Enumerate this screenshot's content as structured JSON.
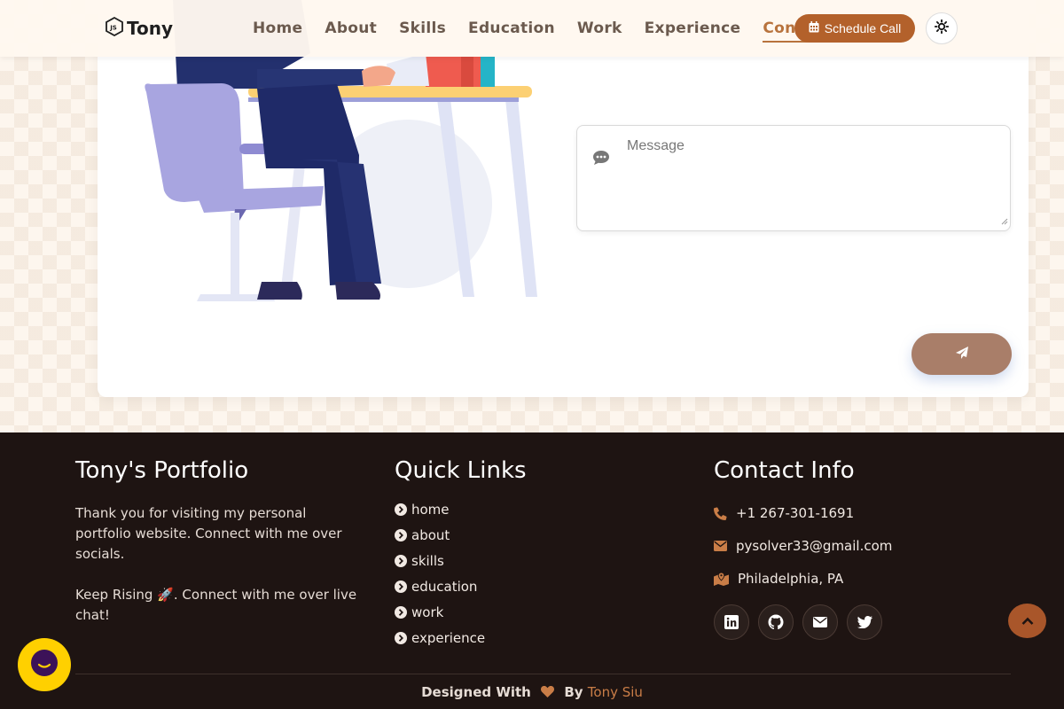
{
  "header": {
    "logo_text": "Tony",
    "nav": [
      {
        "label": "Home"
      },
      {
        "label": "About"
      },
      {
        "label": "Skills"
      },
      {
        "label": "Education"
      },
      {
        "label": "Work"
      },
      {
        "label": "Experience"
      },
      {
        "label": "Contact",
        "active": true
      }
    ],
    "schedule_label": "Schedule Call",
    "theme_icon": "sun-icon"
  },
  "contact_form": {
    "message_placeholder": "Message",
    "message_value": "",
    "send_icon": "paper-plane-icon"
  },
  "footer": {
    "portfolio": {
      "title": "Tony's Portfolio",
      "text1": "Thank you for visiting my personal portfolio website. Connect with me over socials.",
      "text2": "Keep Rising 🚀. Connect with me over live chat!"
    },
    "quick_links": {
      "title": "Quick Links",
      "items": [
        "home",
        "about",
        "skills",
        "education",
        "work",
        "experience"
      ]
    },
    "contact_info": {
      "title": "Contact Info",
      "phone": "+1 267-301-1691",
      "email": "pysolver33@gmail.com",
      "location": "Philadelphia, PA"
    },
    "socials": [
      "linkedin-icon",
      "github-icon",
      "envelope-icon",
      "twitter-icon"
    ],
    "credits": {
      "prefix": "Designed With",
      "by": "By",
      "name": "Tony Siu"
    }
  },
  "colors": {
    "accent": "#b3612b",
    "footer_bg": "#1e1412",
    "link_accent": "#c97d47"
  }
}
